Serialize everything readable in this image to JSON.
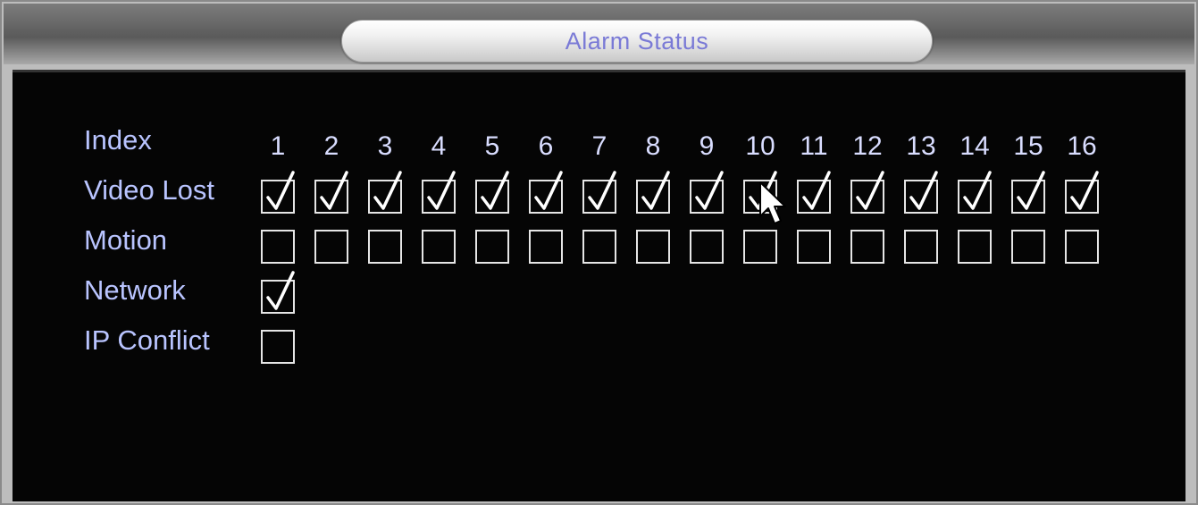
{
  "window": {
    "title": "Alarm Status"
  },
  "labels": {
    "index": "Index",
    "video_lost": "Video Lost",
    "motion": "Motion",
    "network": "Network",
    "ip_conflict": "IP Conflict"
  },
  "channels": [
    "1",
    "2",
    "3",
    "4",
    "5",
    "6",
    "7",
    "8",
    "9",
    "10",
    "11",
    "12",
    "13",
    "14",
    "15",
    "16"
  ],
  "video_lost": [
    true,
    true,
    true,
    true,
    true,
    true,
    true,
    true,
    true,
    true,
    true,
    true,
    true,
    true,
    true,
    true
  ],
  "motion": [
    false,
    false,
    false,
    false,
    false,
    false,
    false,
    false,
    false,
    false,
    false,
    false,
    false,
    false,
    false,
    false
  ],
  "network": true,
  "ip_conflict": false,
  "colors": {
    "label_text": "#b9c4ff",
    "title_text": "#7a7ad6",
    "panel_bg": "#050505",
    "checkbox_border": "#e6e6e6"
  },
  "icons": {
    "checkmark": "checkmark-icon",
    "cursor": "mouse-pointer-icon"
  }
}
